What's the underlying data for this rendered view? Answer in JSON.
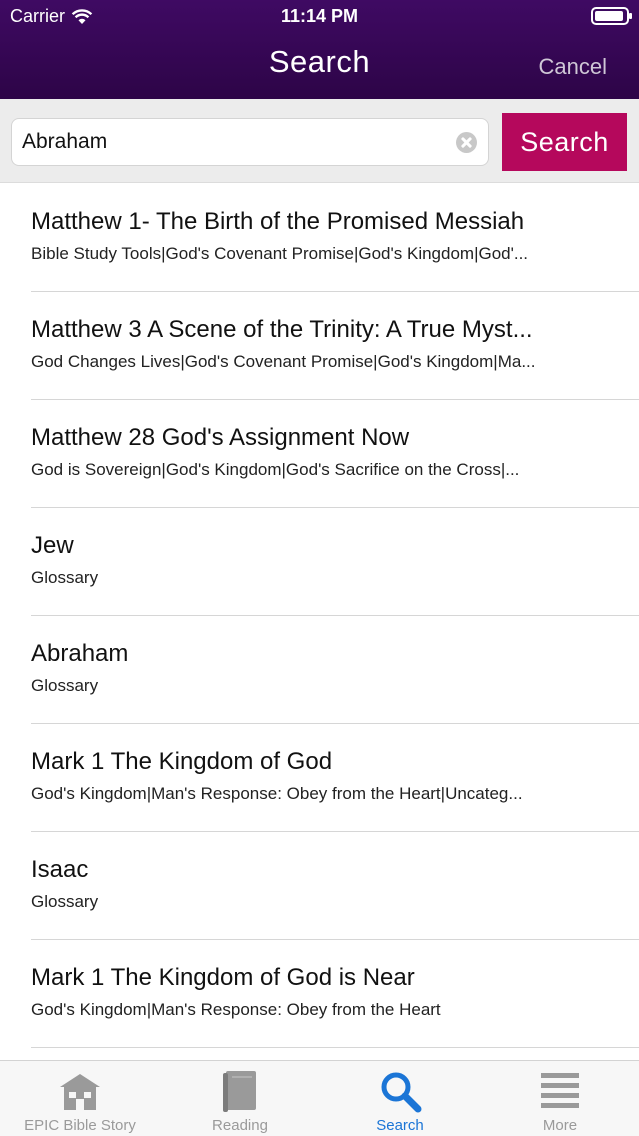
{
  "status_bar": {
    "carrier": "Carrier",
    "time": "11:14 PM"
  },
  "nav": {
    "title": "Search",
    "cancel_label": "Cancel"
  },
  "search": {
    "query": "Abraham",
    "button_label": "Search"
  },
  "results": [
    {
      "title": "Matthew 1- The Birth of the Promised Messiah",
      "subtitle": "Bible Study Tools|God's Covenant Promise|God's Kingdom|God'..."
    },
    {
      "title": "Matthew 3  A Scene of the Trinity: A True Myst...",
      "subtitle": "God Changes Lives|God's Covenant Promise|God's Kingdom|Ma..."
    },
    {
      "title": "Matthew 28 God's Assignment Now",
      "subtitle": "God is Sovereign|God's Kingdom|God's Sacrifice on the Cross|..."
    },
    {
      "title": "Jew",
      "subtitle": "Glossary"
    },
    {
      "title": "Abraham",
      "subtitle": "Glossary"
    },
    {
      "title": "Mark 1 The Kingdom of God",
      "subtitle": "God's Kingdom|Man's Response: Obey from the Heart|Uncateg..."
    },
    {
      "title": "Isaac",
      "subtitle": "Glossary"
    },
    {
      "title": "Mark 1 The Kingdom of God is Near",
      "subtitle": "God's Kingdom|Man's Response: Obey from the Heart"
    }
  ],
  "tabbar": {
    "items": [
      {
        "label": "EPIC Bible Story",
        "icon": "house-icon"
      },
      {
        "label": "Reading",
        "icon": "book-icon"
      },
      {
        "label": "Search",
        "icon": "magnifier-icon"
      },
      {
        "label": "More",
        "icon": "menu-lines-icon"
      }
    ],
    "active_index": 2
  },
  "colors": {
    "nav_background": "#3a0860",
    "search_button": "#b5085c",
    "tab_active": "#1b75d6",
    "tab_inactive": "#9a9a9a"
  }
}
